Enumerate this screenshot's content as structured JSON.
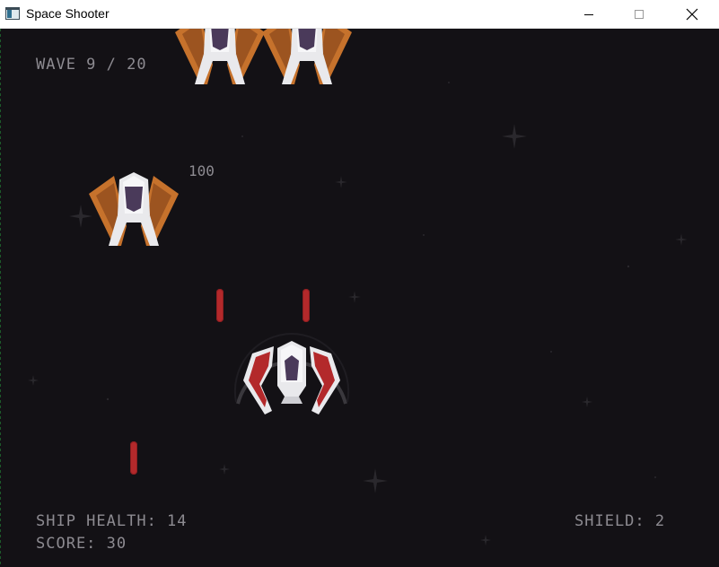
{
  "window": {
    "title": "Space Shooter",
    "icon": "app-window-icon",
    "controls": [
      "minimize-icon",
      "maximize-icon",
      "close-icon"
    ]
  },
  "hud": {
    "wave": "WAVE 9 / 20",
    "ship_health": "SHIP HEALTH: 14",
    "score": "SCORE: 30",
    "shield": "SHIELD: 2"
  },
  "popup": {
    "points": "100"
  },
  "colors": {
    "background": "#131115",
    "hud_text": "#8d8b91",
    "enemy_wing": "#c6722c",
    "player_wing": "#b3292b",
    "laser": "#b3292b",
    "ship_hull": "#e9e9ec",
    "cockpit": "#4a3a5a"
  },
  "sprites": {
    "enemies": [
      "enemy-ship",
      "enemy-ship",
      "enemy-ship"
    ],
    "player": "player-ship",
    "player_shield": "shield-ring",
    "projectiles": [
      "laser-bolt",
      "laser-bolt",
      "laser-bolt"
    ]
  }
}
